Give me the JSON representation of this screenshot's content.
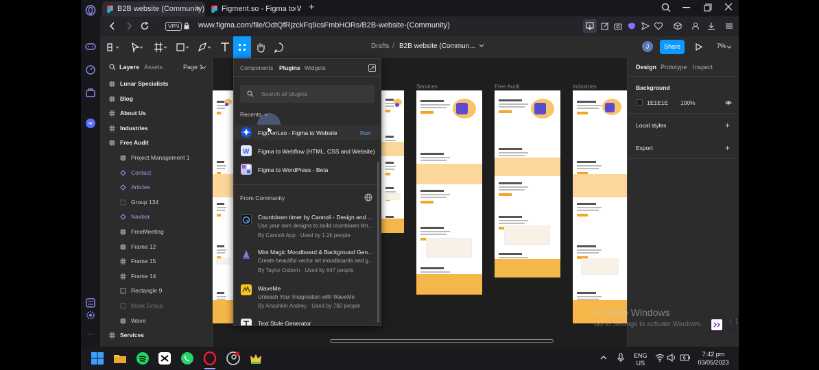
{
  "browser": {
    "tabs": [
      {
        "title": "B2B website (Community)",
        "close": "×"
      },
      {
        "title": "Figment.so - Figma to Web",
        "close": "×"
      }
    ],
    "new_tab": "+",
    "vpn": "VPN",
    "url": "www.figma.com/file/OdtQfRjzckFq9csFmbHORs/B2B-website-(Community)"
  },
  "figma": {
    "breadcrumb": {
      "drafts": "Drafts",
      "sep": "/",
      "file": "B2B website (Commun..."
    },
    "avatar": "J",
    "share": "Share",
    "zoom": "7%",
    "left_tabs": {
      "layers": "Layers",
      "assets": "Assets",
      "page": "Page 1"
    },
    "layers": [
      {
        "name": "Lunar Specialists",
        "type": "frame",
        "indent": 0
      },
      {
        "name": "Blog",
        "type": "frame",
        "indent": 0
      },
      {
        "name": "About Us",
        "type": "frame",
        "indent": 0
      },
      {
        "name": "Industries",
        "type": "frame",
        "indent": 0
      },
      {
        "name": "Free Audit",
        "type": "frame",
        "indent": 0
      },
      {
        "name": "Project Management 1",
        "type": "frame",
        "indent": 1
      },
      {
        "name": "Contact",
        "type": "component",
        "indent": 1
      },
      {
        "name": "Articles",
        "type": "component",
        "indent": 1
      },
      {
        "name": "Group 134",
        "type": "group",
        "indent": 1
      },
      {
        "name": "Navbar",
        "type": "component",
        "indent": 1
      },
      {
        "name": "FreeMeeting",
        "type": "frame",
        "indent": 1
      },
      {
        "name": "Frame 12",
        "type": "frame",
        "indent": 1
      },
      {
        "name": "Frame 15",
        "type": "frame",
        "indent": 1
      },
      {
        "name": "Frame 14",
        "type": "frame",
        "indent": 1
      },
      {
        "name": "Rectangle 9",
        "type": "rect",
        "indent": 1
      },
      {
        "name": "Mask Group",
        "type": "group",
        "indent": 1
      },
      {
        "name": "Wave",
        "type": "frame",
        "indent": 1
      },
      {
        "name": "Services",
        "type": "frame",
        "indent": 0
      }
    ],
    "canvas_labels": {
      "services": "Services",
      "free_audit": "Free Audit",
      "industries": "Industries"
    },
    "right_panel": {
      "tabs": {
        "design": "Design",
        "prototype": "Prototype",
        "inspect": "Inspect"
      },
      "background_title": "Background",
      "bg_hex": "1E1E1E",
      "bg_opacity": "100%",
      "bg_color": "#1E1E1E",
      "local_styles": "Local styles",
      "export": "Export"
    },
    "plugins": {
      "tabs": {
        "components": "Components",
        "plugins": "Plugins",
        "widgets": "Widgets"
      },
      "search_placeholder": "Search all plugins",
      "recents_label": "Recents",
      "recents": [
        {
          "name": "Figment.so - Figma to Website",
          "action": "Run",
          "icon": "figment-icon"
        },
        {
          "name": "Figma to Webflow (HTML, CSS and Website)",
          "icon": "webflow-icon"
        },
        {
          "name": "Figma to WordPress - Beta",
          "icon": "wordpress-icon"
        }
      ],
      "community_label": "From Community",
      "community": [
        {
          "name": "Countdown timer by Cannoli - Design and ...",
          "desc": "Use your own designs to build countdown tim...",
          "meta": "By Cannoli App · Used by 1.2k people"
        },
        {
          "name": "Mini Magic Moodboard & Background Gen...",
          "desc": "Create beautiful vector art moodboards and g...",
          "meta": "By Taylor Osborn · Used by 647 people"
        },
        {
          "name": "WaveMe",
          "desc": "Unleash Your Imagination with WaveMe",
          "meta": "By Anashkin Andrey · Used by 782 people"
        },
        {
          "name": "Text Style Generator",
          "desc": "",
          "meta": ""
        }
      ]
    }
  },
  "watermark": {
    "title": "Activate Windows",
    "subtitle": "Go to Settings to activate Windows."
  },
  "taskbar": {
    "lang": "ENG",
    "region": "US",
    "time": "7:42 pm",
    "date": "03/05/2023"
  },
  "colors": {
    "accent": "#0d99ff",
    "orange": "#f5a623",
    "opera_red": "#ff1b2d"
  }
}
